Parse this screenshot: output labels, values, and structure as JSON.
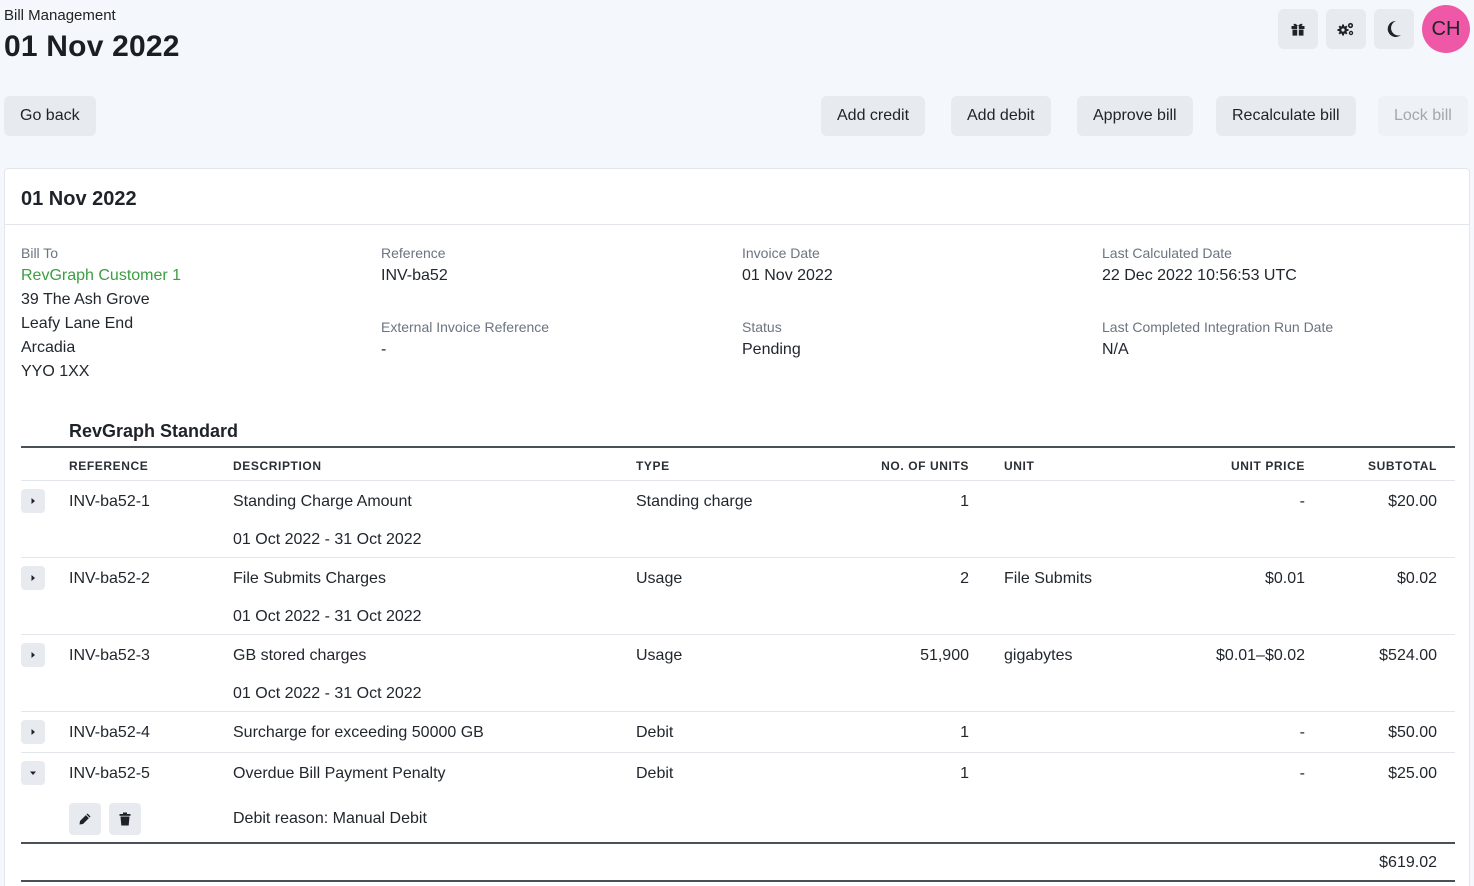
{
  "header": {
    "section": "Bill Management",
    "title": "01 Nov 2022",
    "avatar_initials": "CH",
    "icons": [
      "gift-icon",
      "cogs-icon",
      "moon-icon"
    ]
  },
  "actions": {
    "go_back": "Go back",
    "add_credit": "Add credit",
    "add_debit": "Add debit",
    "approve_bill": "Approve bill",
    "recalculate_bill": "Recalculate bill",
    "lock_bill": "Lock bill"
  },
  "bill": {
    "title": "01 Nov 2022",
    "bill_to_label": "Bill To",
    "customer_name": "RevGraph Customer 1",
    "address": [
      "39 The Ash Grove",
      "Leafy Lane End",
      "Arcadia",
      "YYO 1XX"
    ],
    "reference_label": "Reference",
    "reference": "INV-ba52",
    "external_ref_label": "External Invoice Reference",
    "external_ref": "-",
    "invoice_date_label": "Invoice Date",
    "invoice_date": "01 Nov 2022",
    "status_label": "Status",
    "status": "Pending",
    "last_calc_label": "Last Calculated Date",
    "last_calc": "22 Dec 2022 10:56:53 UTC",
    "last_integration_label": "Last Completed Integration Run Date",
    "last_integration": "N/A"
  },
  "table": {
    "section_title": "RevGraph Standard",
    "columns": {
      "reference": "REFERENCE",
      "description": "DESCRIPTION",
      "type": "TYPE",
      "units": "NO. OF UNITS",
      "unit": "UNIT",
      "unit_price": "UNIT PRICE",
      "subtotal": "SUBTOTAL"
    },
    "rows": [
      {
        "reference": "INV-ba52-1",
        "description": "Standing Charge Amount",
        "period": "01 Oct 2022 - 31 Oct 2022",
        "type": "Standing charge",
        "units": "1",
        "unit": "",
        "unit_price": "-",
        "subtotal": "$20.00"
      },
      {
        "reference": "INV-ba52-2",
        "description": "File Submits Charges",
        "period": "01 Oct 2022 - 31 Oct 2022",
        "type": "Usage",
        "units": "2",
        "unit": "File Submits",
        "unit_price": "$0.01",
        "subtotal": "$0.02"
      },
      {
        "reference": "INV-ba52-3",
        "description": "GB stored charges",
        "period": "01 Oct 2022 - 31 Oct 2022",
        "type": "Usage",
        "units": "51,900",
        "unit": "gigabytes",
        "unit_price": "$0.01–$0.02",
        "subtotal": "$524.00"
      },
      {
        "reference": "INV-ba52-4",
        "description": "Surcharge for exceeding 50000 GB",
        "type": "Debit",
        "units": "1",
        "unit": "",
        "unit_price": "-",
        "subtotal": "$50.00"
      },
      {
        "reference": "INV-ba52-5",
        "description": "Overdue Bill Payment Penalty",
        "type": "Debit",
        "units": "1",
        "unit": "",
        "unit_price": "-",
        "subtotal": "$25.00",
        "detail": "Debit reason: Manual Debit"
      }
    ],
    "total": "$619.02"
  },
  "colors": {
    "link": "#3a9e42",
    "avatar": "#ee58a6",
    "button_bg": "#e7ebf0",
    "page_bg": "#f4f7fb"
  }
}
